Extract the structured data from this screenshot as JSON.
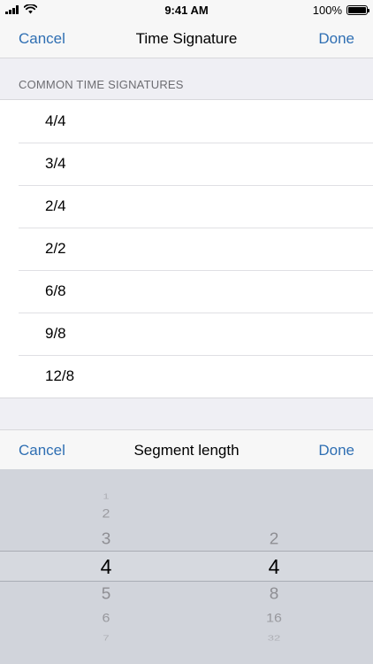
{
  "status_bar": {
    "time": "9:41 AM",
    "battery": "100%",
    "battery_level": 1.0,
    "signal_icon": "signal-bars-icon",
    "wifi_icon": "wifi-icon",
    "battery_icon": "battery-icon"
  },
  "nav": {
    "left": "Cancel",
    "title": "Time Signature",
    "right": "Done"
  },
  "section": {
    "header": "COMMON TIME SIGNATURES"
  },
  "time_signatures": [
    "4/4",
    "3/4",
    "2/4",
    "2/2",
    "6/8",
    "9/8",
    "12/8"
  ],
  "picker_toolbar": {
    "left": "Cancel",
    "title": "Segment length",
    "right": "Done"
  },
  "picker": {
    "left_column": {
      "items": [
        "1",
        "2",
        "3",
        "4",
        "5",
        "6",
        "7"
      ],
      "selected": "4"
    },
    "right_column": {
      "items": [
        "2",
        "4",
        "8",
        "16",
        "32"
      ],
      "selected": "4"
    }
  },
  "colors": {
    "accent": "#2f6fb3",
    "background": "#efeff4",
    "picker_background": "#d1d4db"
  }
}
